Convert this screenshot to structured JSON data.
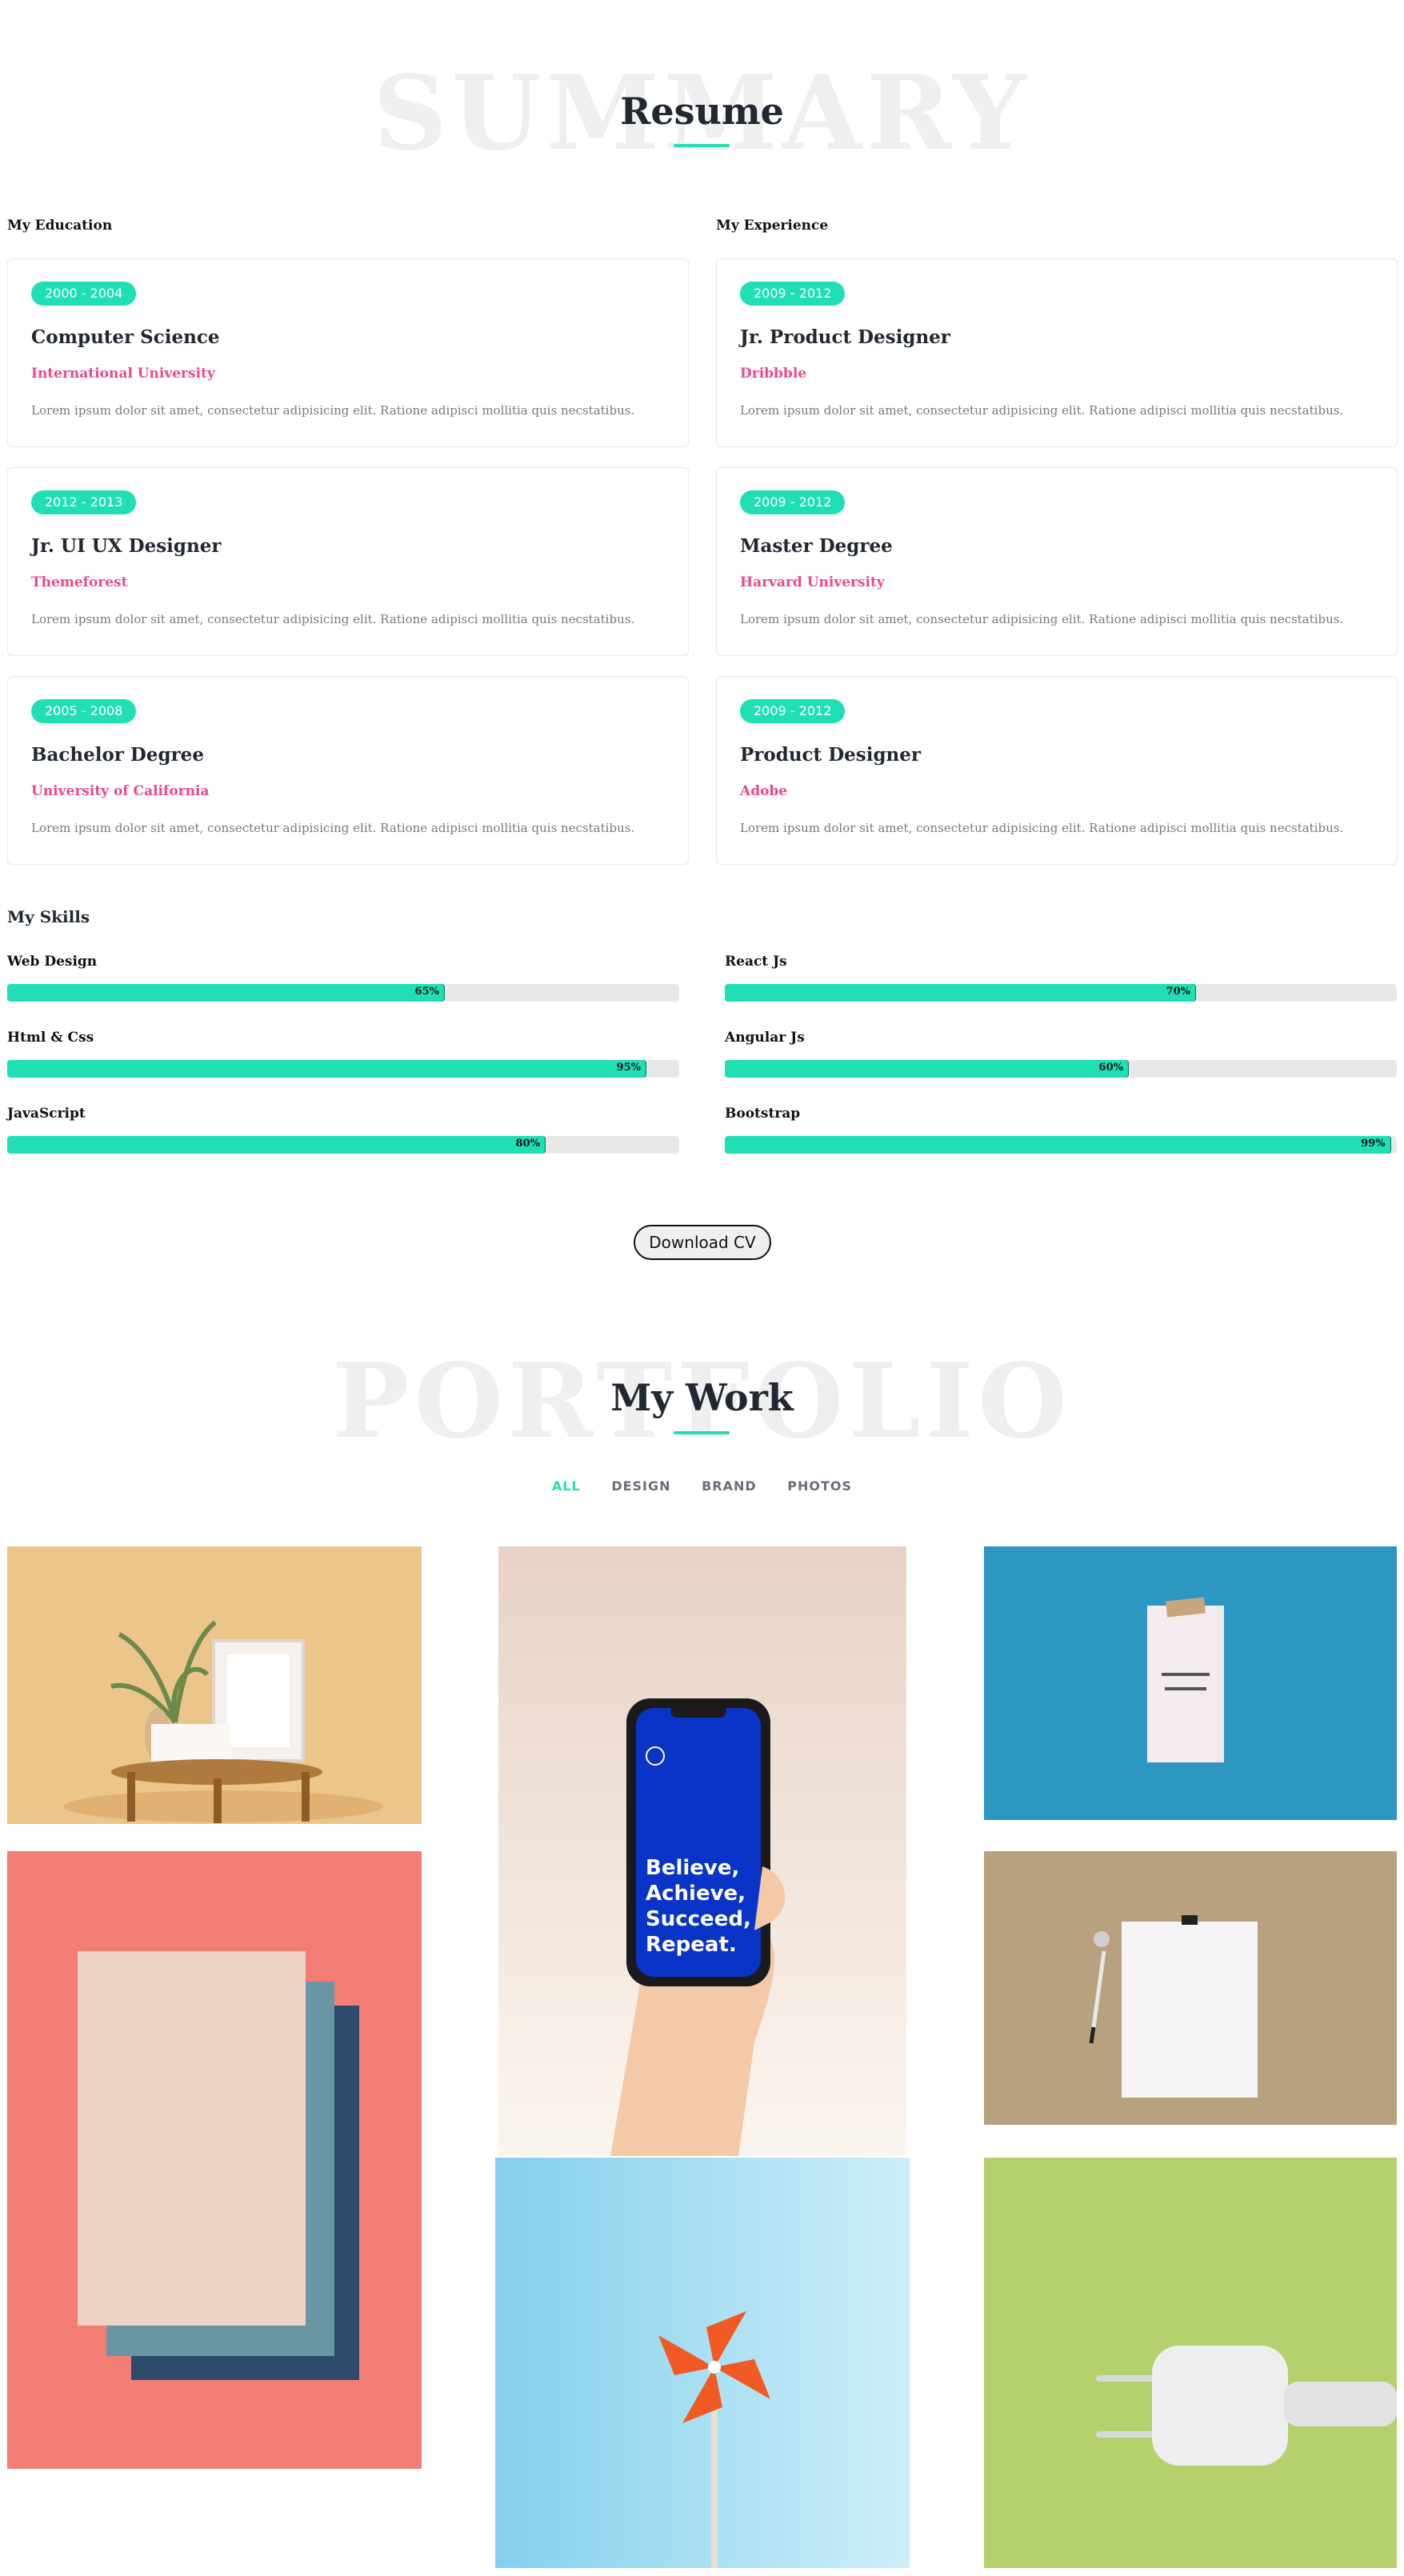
{
  "resume": {
    "bg_word": "SUMMARY",
    "title": "Resume",
    "education_label": "My Education",
    "experience_label": "My Experience",
    "education": [
      {
        "years": "2000 - 2004",
        "title": "Computer Science",
        "org": "International University",
        "desc": "Lorem ipsum dolor sit amet, consectetur adipisicing elit. Ratione adipisci mollitia quis necstatibus."
      },
      {
        "years": "2012 - 2013",
        "title": "Jr. UI UX Designer",
        "org": "Themeforest",
        "desc": "Lorem ipsum dolor sit amet, consectetur adipisicing elit. Ratione adipisci mollitia quis necstatibus."
      },
      {
        "years": "2005 - 2008",
        "title": "Bachelor Degree",
        "org": "University of California",
        "desc": "Lorem ipsum dolor sit amet, consectetur adipisicing elit. Ratione adipisci mollitia quis necstatibus."
      }
    ],
    "experience": [
      {
        "years": "2009 - 2012",
        "title": "Jr. Product Designer",
        "org": "Dribbble",
        "desc": "Lorem ipsum dolor sit amet, consectetur adipisicing elit. Ratione adipisci mollitia quis necstatibus."
      },
      {
        "years": "2009 - 2012",
        "title": "Master Degree",
        "org": "Harvard University",
        "desc": "Lorem ipsum dolor sit amet, consectetur adipisicing elit. Ratione adipisci mollitia quis necstatibus."
      },
      {
        "years": "2009 - 2012",
        "title": "Product Designer",
        "org": "Adobe",
        "desc": "Lorem ipsum dolor sit amet, consectetur adipisicing elit. Ratione adipisci mollitia quis necstatibus."
      }
    ]
  },
  "skills": {
    "title": "My Skills",
    "left": [
      {
        "name": "Web Design",
        "percent": 65,
        "label": "65%"
      },
      {
        "name": "Html & Css",
        "percent": 95,
        "label": "95%"
      },
      {
        "name": "JavaScript",
        "percent": 80,
        "label": "80%"
      }
    ],
    "right": [
      {
        "name": "React Js",
        "percent": 70,
        "label": "70%"
      },
      {
        "name": "Angular Js",
        "percent": 60,
        "label": "60%"
      },
      {
        "name": "Bootstrap",
        "percent": 99,
        "label": "99%"
      }
    ]
  },
  "download_cv_label": "Download CV",
  "portfolio": {
    "bg_word": "PORTFOLIO",
    "title": "My Work",
    "filters": [
      "ALL",
      "DESIGN",
      "BRAND",
      "PHOTOS"
    ],
    "active_filter": "ALL",
    "phone_text": [
      "Believe,",
      "Achieve,",
      "Succeed,",
      "Repeat."
    ]
  },
  "colors": {
    "accent": "#20dfb4",
    "org_pink": "#e84a8a",
    "heading": "#222831"
  }
}
